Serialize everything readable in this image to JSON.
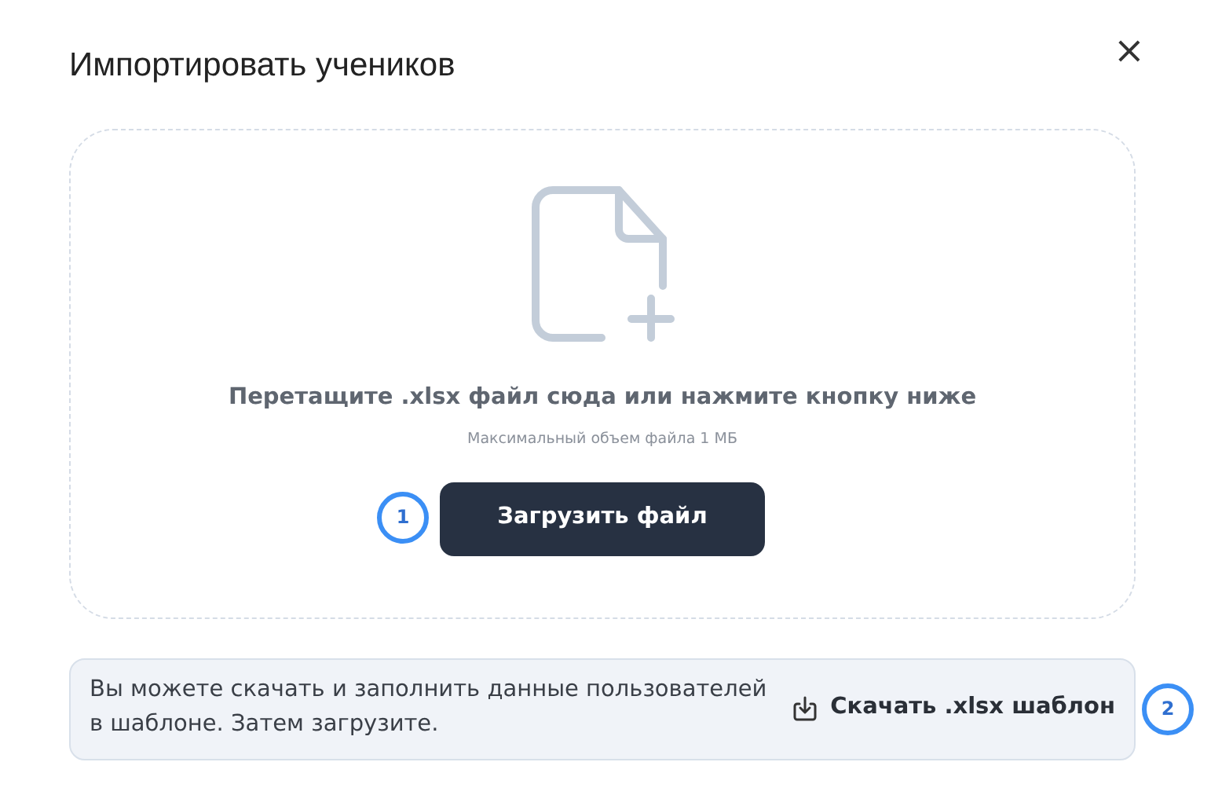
{
  "dialog": {
    "title": "Импортировать учеников",
    "close": "×"
  },
  "dropzone": {
    "hint": "Перетащите .xlsx файл сюда или нажмите кнопку ниже",
    "limit": "Максимальный объем файла 1 МБ",
    "button": "Загрузить файл",
    "marker": "1"
  },
  "template": {
    "text": "Вы можете скачать и заполнить данные пользователей в шаблоне. Затем загрузите.",
    "link": "Скачать .xlsx шаблон",
    "marker": "2"
  }
}
